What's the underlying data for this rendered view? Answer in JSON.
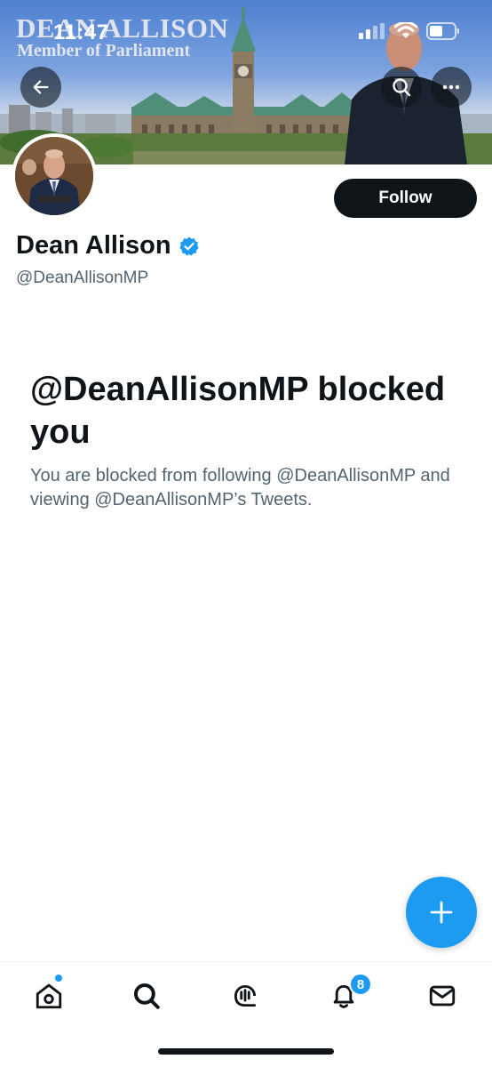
{
  "status_bar": {
    "time": "11:47"
  },
  "banner": {
    "title": "DEAN ALLISON",
    "subtitle": "Member of Parliament"
  },
  "header": {
    "back_icon": "arrow-left-icon",
    "search_icon": "search-icon",
    "more_icon": "more-horizontal-icon"
  },
  "profile": {
    "display_name": "Dean Allison",
    "verified_icon": "verified-badge-icon",
    "handle": "@DeanAllisonMP",
    "follow_label": "Follow"
  },
  "blocked": {
    "title": "@DeanAllisonMP blocked you",
    "description": "You are blocked from following @DeanAllisonMP and viewing @DeanAllisonMP’s Tweets."
  },
  "compose": {
    "icon": "plus-icon"
  },
  "bottom_nav": {
    "items": [
      {
        "name": "home",
        "icon": "home-icon"
      },
      {
        "name": "search",
        "icon": "search-icon"
      },
      {
        "name": "spaces",
        "icon": "spaces-icon"
      },
      {
        "name": "notifications",
        "icon": "bell-icon",
        "badge": "8"
      },
      {
        "name": "messages",
        "icon": "mail-icon"
      }
    ]
  },
  "colors": {
    "accent": "#1d9bf0",
    "text_primary": "#0f1419",
    "text_secondary": "#536471"
  }
}
